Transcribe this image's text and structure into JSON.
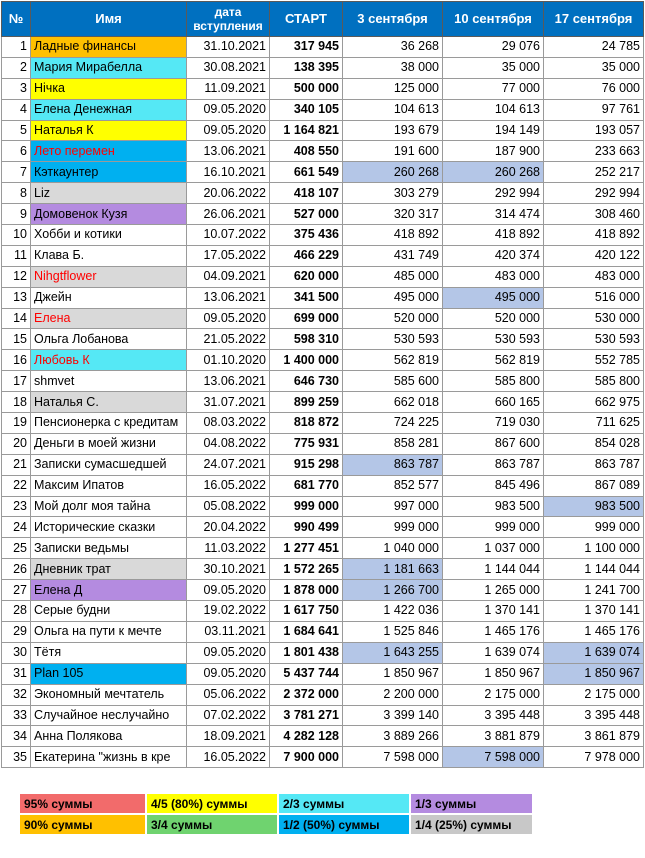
{
  "colors": {
    "header_bg": "#0070c0",
    "orange": "#ffc000",
    "cyan": "#55e8f5",
    "yellow": "#ffff00",
    "blue": "#00b0f0",
    "purple": "#b48be0",
    "grey": "#d9d9d9",
    "red_text": "#ff0000",
    "highlight": "#b4c6e7"
  },
  "header": {
    "num": "№",
    "name": "Имя",
    "joined": "дата вступления",
    "start": "СТАРТ",
    "col1": "3 сентября",
    "col2": "10 сентября",
    "col3": "17 сентября"
  },
  "rows": [
    {
      "n": "1",
      "name": "Ладные финансы",
      "date": "31.10.2021",
      "start": "317 945",
      "v1": "36 268",
      "v2": "29 076",
      "v3": "24 785",
      "bg": "orange"
    },
    {
      "n": "2",
      "name": "Мария Мирабелла",
      "date": "30.08.2021",
      "start": "138 395",
      "v1": "38 000",
      "v2": "35 000",
      "v3": "35 000",
      "bg": "cyan"
    },
    {
      "n": "3",
      "name": "Нічка",
      "date": "11.09.2021",
      "start": "500 000",
      "v1": "125 000",
      "v2": "77 000",
      "v3": "76 000",
      "bg": "yellow"
    },
    {
      "n": "4",
      "name": "Елена Денежная",
      "date": "09.05.2020",
      "start": "340 105",
      "v1": "104 613",
      "v2": "104 613",
      "v3": "97 761",
      "bg": "cyan"
    },
    {
      "n": "5",
      "name": "Наталья К",
      "date": "09.05.2020",
      "start": "1 164 821",
      "v1": "193 679",
      "v2": "194 149",
      "v3": "193 057",
      "bg": "yellow"
    },
    {
      "n": "6",
      "name": "Лето перемен",
      "date": "13.06.2021",
      "start": "408 550",
      "v1": "191 600",
      "v2": "187 900",
      "v3": "233 663",
      "bg": "blue",
      "red": true
    },
    {
      "n": "7",
      "name": "Кэткаунтер",
      "date": "16.10.2021",
      "start": "661 549",
      "v1": "260 268",
      "v2": "260 268",
      "v3": "252 217",
      "bg": "blue",
      "h1": true,
      "h2": true
    },
    {
      "n": "8",
      "name": "Liz",
      "date": "20.06.2022",
      "start": "418 107",
      "v1": "303 279",
      "v2": "292 994",
      "v3": "292 994",
      "bg": "grey"
    },
    {
      "n": "9",
      "name": "Домовенок Кузя",
      "date": "26.06.2021",
      "start": "527 000",
      "v1": "320 317",
      "v2": "314 474",
      "v3": "308 460",
      "bg": "purple"
    },
    {
      "n": "10",
      "name": "Хобби и котики",
      "date": "10.07.2022",
      "start": "375 436",
      "v1": "418 892",
      "v2": "418 892",
      "v3": "418 892",
      "bg": ""
    },
    {
      "n": "11",
      "name": "Клава Б.",
      "date": "17.05.2022",
      "start": "466 229",
      "v1": "431 749",
      "v2": "420 374",
      "v3": "420 122",
      "bg": ""
    },
    {
      "n": "12",
      "name": "Nihgtflower",
      "date": "04.09.2021",
      "start": "620 000",
      "v1": "485 000",
      "v2": "483 000",
      "v3": "483 000",
      "bg": "grey",
      "red": true
    },
    {
      "n": "13",
      "name": "Джейн",
      "date": "13.06.2021",
      "start": "341 500",
      "v1": "495 000",
      "v2": "495 000",
      "v3": "516 000",
      "bg": "",
      "h2": true
    },
    {
      "n": "14",
      "name": "Елена",
      "date": "09.05.2020",
      "start": "699 000",
      "v1": "520 000",
      "v2": "520 000",
      "v3": "530 000",
      "bg": "grey",
      "red": true
    },
    {
      "n": "15",
      "name": "Ольга Лобанова",
      "date": "21.05.2022",
      "start": "598 310",
      "v1": "530 593",
      "v2": "530 593",
      "v3": "530 593",
      "bg": ""
    },
    {
      "n": "16",
      "name": "Любовь К",
      "date": "01.10.2020",
      "start": "1 400 000",
      "v1": "562 819",
      "v2": "562 819",
      "v3": "552 785",
      "bg": "cyan",
      "red": true
    },
    {
      "n": "17",
      "name": "shmvet",
      "date": "13.06.2021",
      "start": "646 730",
      "v1": "585 600",
      "v2": "585 800",
      "v3": "585 800",
      "bg": ""
    },
    {
      "n": "18",
      "name": "Наталья С.",
      "date": "31.07.2021",
      "start": "899 259",
      "v1": "662 018",
      "v2": "660 165",
      "v3": "662 975",
      "bg": "grey"
    },
    {
      "n": "19",
      "name": "Пенсионерка с кредитам",
      "date": "08.03.2022",
      "start": "818 872",
      "v1": "724 225",
      "v2": "719 030",
      "v3": "711 625",
      "bg": ""
    },
    {
      "n": "20",
      "name": "Деньги в моей жизни",
      "date": "04.08.2022",
      "start": "775 931",
      "v1": "858 281",
      "v2": "867 600",
      "v3": "854 028",
      "bg": ""
    },
    {
      "n": "21",
      "name": "Записки сумасшедшей",
      "date": "24.07.2021",
      "start": "915 298",
      "v1": "863 787",
      "v2": "863 787",
      "v3": "863 787",
      "bg": "",
      "h1": true
    },
    {
      "n": "22",
      "name": "Максим Ипатов",
      "date": "16.05.2022",
      "start": "681 770",
      "v1": "852 577",
      "v2": "845 496",
      "v3": "867 089",
      "bg": ""
    },
    {
      "n": "23",
      "name": "Мой долг моя тайна",
      "date": "05.08.2022",
      "start": "999 000",
      "v1": "997 000",
      "v2": "983 500",
      "v3": "983 500",
      "bg": "",
      "h3": true
    },
    {
      "n": "24",
      "name": "Исторические сказки",
      "date": "20.04.2022",
      "start": "990 499",
      "v1": "999 000",
      "v2": "999 000",
      "v3": "999 000",
      "bg": ""
    },
    {
      "n": "25",
      "name": "Записки ведьмы",
      "date": "11.03.2022",
      "start": "1 277 451",
      "v1": "1 040 000",
      "v2": "1 037 000",
      "v3": "1 100 000",
      "bg": ""
    },
    {
      "n": "26",
      "name": "Дневник трат",
      "date": "30.10.2021",
      "start": "1 572 265",
      "v1": "1 181 663",
      "v2": "1 144 044",
      "v3": "1 144 044",
      "bg": "grey",
      "h1": true
    },
    {
      "n": "27",
      "name": "Елена Д",
      "date": "09.05.2020",
      "start": "1 878 000",
      "v1": "1 266 700",
      "v2": "1 265 000",
      "v3": "1 241 700",
      "bg": "purple",
      "h1": true
    },
    {
      "n": "28",
      "name": "Серые будни",
      "date": "19.02.2022",
      "start": "1 617 750",
      "v1": "1 422 036",
      "v2": "1 370 141",
      "v3": "1 370 141",
      "bg": ""
    },
    {
      "n": "29",
      "name": "Ольга на пути к мечте",
      "date": "03.11.2021",
      "start": "1 684 641",
      "v1": "1 525 846",
      "v2": "1 465 176",
      "v3": "1 465 176",
      "bg": ""
    },
    {
      "n": "30",
      "name": "Тётя",
      "date": "09.05.2020",
      "start": "1 801 438",
      "v1": "1 643 255",
      "v2": "1 639 074",
      "v3": "1 639 074",
      "bg": "",
      "h1": true,
      "h3": true
    },
    {
      "n": "31",
      "name": "Plan 105",
      "date": "09.05.2020",
      "start": "5 437 744",
      "v1": "1 850 967",
      "v2": "1 850 967",
      "v3": "1 850 967",
      "bg": "blue",
      "h3": true
    },
    {
      "n": "32",
      "name": "Экономный мечтатель",
      "date": "05.06.2022",
      "start": "2 372 000",
      "v1": "2 200 000",
      "v2": "2 175 000",
      "v3": "2 175 000",
      "bg": ""
    },
    {
      "n": "33",
      "name": "Случайное неслучайно",
      "date": "07.02.2022",
      "start": "3 781 271",
      "v1": "3 399 140",
      "v2": "3 395 448",
      "v3": "3 395 448",
      "bg": ""
    },
    {
      "n": "34",
      "name": "Анна Полякова",
      "date": "18.09.2021",
      "start": "4 282 128",
      "v1": "3 889 266",
      "v2": "3 881 879",
      "v3": "3 861 879",
      "bg": ""
    },
    {
      "n": "35",
      "name": "Екатерина \"жизнь в кре",
      "date": "16.05.2022",
      "start": "7 900 000",
      "v1": "7 598 000",
      "v2": "7 598 000",
      "v3": "7 978 000",
      "bg": "",
      "h2": true
    }
  ],
  "legend": [
    [
      {
        "label": "95% суммы",
        "color": "#f26b6b"
      },
      {
        "label": "4/5 (80%) суммы",
        "color": "#ffff00"
      },
      {
        "label": "2/3 суммы",
        "color": "#55e8f5"
      },
      {
        "label": "1/3 суммы",
        "color": "#b48be0"
      }
    ],
    [
      {
        "label": "90% суммы",
        "color": "#ffc000"
      },
      {
        "label": "3/4 суммы",
        "color": "#6fd36f"
      },
      {
        "label": "1/2 (50%) суммы",
        "color": "#00b0f0"
      },
      {
        "label": "1/4 (25%) суммы",
        "color": "#c8c8c8"
      }
    ]
  ]
}
